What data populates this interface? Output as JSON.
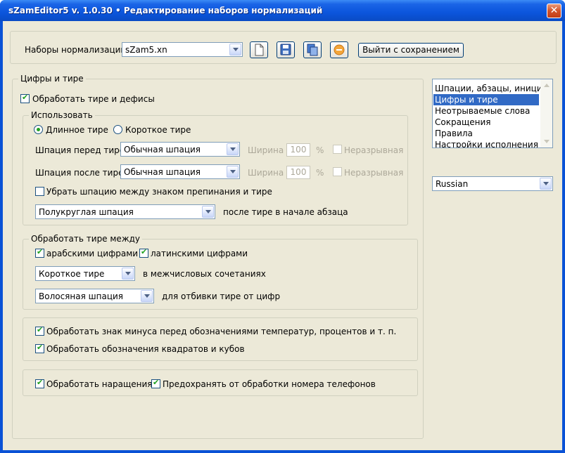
{
  "window": {
    "title": "sZamEditor5 v. 1.0.30 • Редактирование наборов нормализаций",
    "close_glyph": "✕"
  },
  "sets": {
    "label": "Наборы нормализаций",
    "selected": "sZam5.xn",
    "exit_button": "Выйти с сохранением",
    "icons": [
      "new-file-icon",
      "save-icon",
      "copy-icon",
      "delete-icon"
    ]
  },
  "main": {
    "legend": "Цифры и тире",
    "process_dashes": {
      "label": "Обработать тире и дефисы",
      "checked": true
    },
    "use": {
      "legend": "Использовать",
      "long_dash": "Длинное тире",
      "short_dash": "Короткое тире",
      "selected": "long",
      "space_before": {
        "label": "Шпация перед тире",
        "value": "Обычная шпация",
        "width_label": "Ширина",
        "width_value": "100",
        "unit": "%",
        "nonbreaking": "Неразрывная"
      },
      "space_after": {
        "label": "Шпация после тире",
        "value": "Обычная шпация",
        "width_label": "Ширина",
        "width_value": "100",
        "unit": "%",
        "nonbreaking": "Неразрывная"
      },
      "remove_space": {
        "label": "Убрать шпацию между знаком препинания и тире",
        "checked": false
      },
      "para_start": {
        "value": "Полукруглая шпация",
        "suffix": "после тире в начале абзаца"
      }
    },
    "between": {
      "legend": "Обработать тире между",
      "arabic": {
        "label": "арабскими цифрами",
        "checked": true
      },
      "latin": {
        "label": "латинскими цифрами",
        "checked": true
      },
      "dash_type": {
        "value": "Короткое тире",
        "suffix": "в межчисловых сочетаниях"
      },
      "space_type": {
        "value": "Волосяная шпация",
        "suffix": "для отбивки тире от цифр"
      }
    },
    "minus": {
      "label": "Обработать знак минуса перед обозначениями температур, процентов и т. п.",
      "checked": true
    },
    "squares": {
      "label": "Обработать обозначения квадратов и кубов",
      "checked": true
    },
    "increments": {
      "label": "Обработать наращения",
      "checked": true
    },
    "phones": {
      "label": "Предохранять от обработки номера телефонов",
      "checked": true
    }
  },
  "categories": {
    "items": [
      "Шпации, абзацы, инициал",
      "Цифры и тире",
      "Неотрываемые слова",
      "Сокращения",
      "Правила",
      "Настройки исполнения"
    ],
    "selected_index": 1
  },
  "language": {
    "value": "Russian"
  }
}
